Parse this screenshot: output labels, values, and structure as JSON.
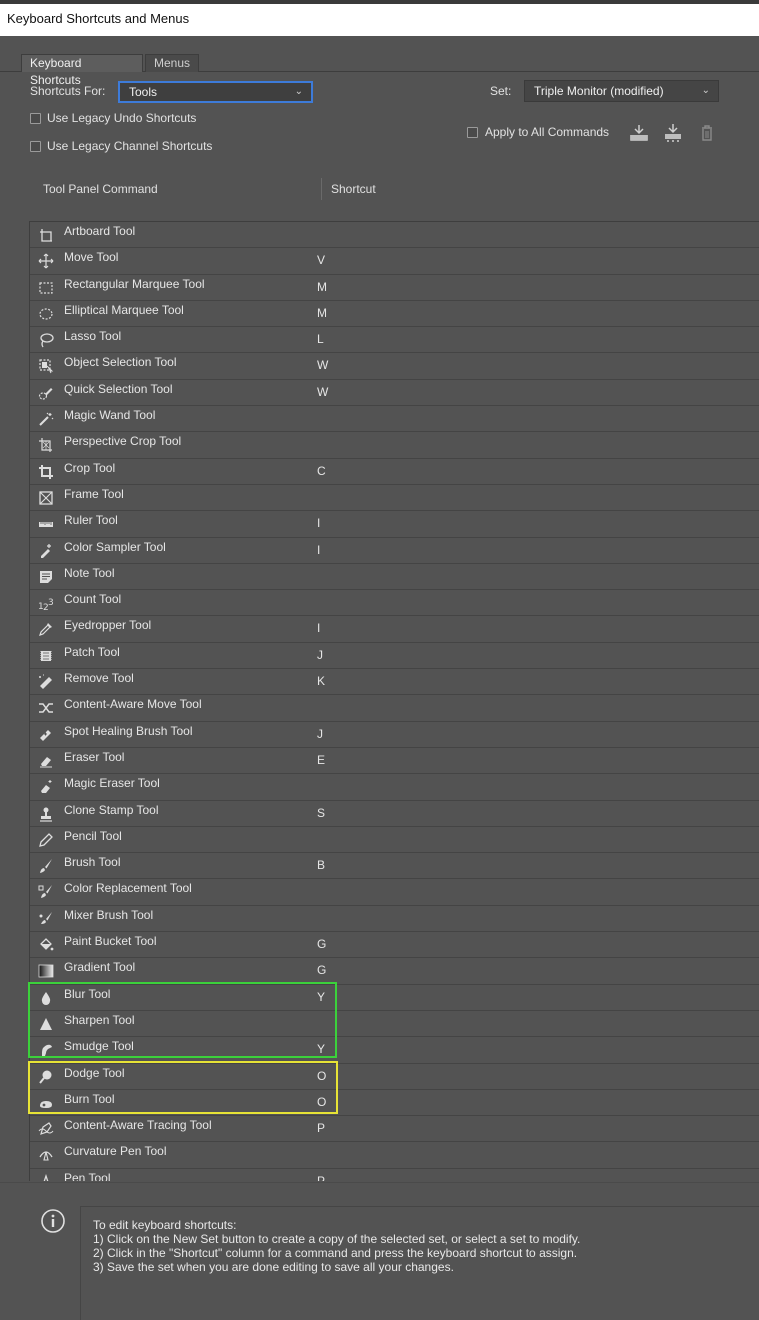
{
  "window": {
    "title": "Keyboard Shortcuts and Menus"
  },
  "tabs": [
    "Keyboard Shortcuts",
    "Menus"
  ],
  "shortcuts_for": {
    "label": "Shortcuts For:",
    "value": "Tools"
  },
  "set": {
    "label": "Set:",
    "value": "Triple Monitor (modified)"
  },
  "options": {
    "legacy_undo": "Use Legacy Undo Shortcuts",
    "legacy_channel": "Use Legacy Channel Shortcuts",
    "apply_all": "Apply to All Commands"
  },
  "columns": {
    "command": "Tool Panel Command",
    "shortcut": "Shortcut"
  },
  "tools": [
    {
      "name": "Artboard Tool",
      "key": "",
      "icon": "artboard-icon"
    },
    {
      "name": "Move Tool",
      "key": "V",
      "icon": "move-icon"
    },
    {
      "name": "Rectangular Marquee Tool",
      "key": "M",
      "icon": "rect-marquee-icon"
    },
    {
      "name": "Elliptical Marquee Tool",
      "key": "M",
      "icon": "ellipse-marquee-icon"
    },
    {
      "name": "Lasso Tool",
      "key": "L",
      "icon": "lasso-icon"
    },
    {
      "name": "Object Selection Tool",
      "key": "W",
      "icon": "object-selection-icon"
    },
    {
      "name": "Quick Selection Tool",
      "key": "W",
      "icon": "quick-selection-icon"
    },
    {
      "name": "Magic Wand Tool",
      "key": "",
      "icon": "magic-wand-icon"
    },
    {
      "name": "Perspective Crop Tool",
      "key": "",
      "icon": "perspective-crop-icon"
    },
    {
      "name": "Crop Tool",
      "key": "C",
      "icon": "crop-icon"
    },
    {
      "name": "Frame Tool",
      "key": "",
      "icon": "frame-icon"
    },
    {
      "name": "Ruler Tool",
      "key": "I",
      "icon": "ruler-icon"
    },
    {
      "name": "Color Sampler Tool",
      "key": "I",
      "icon": "color-sampler-icon"
    },
    {
      "name": "Note Tool",
      "key": "",
      "icon": "note-icon"
    },
    {
      "name": "Count Tool",
      "key": "",
      "icon": "count-icon"
    },
    {
      "name": "Eyedropper Tool",
      "key": "I",
      "icon": "eyedropper-icon"
    },
    {
      "name": "Patch Tool",
      "key": "J",
      "icon": "patch-icon"
    },
    {
      "name": "Remove Tool",
      "key": "K",
      "icon": "remove-icon"
    },
    {
      "name": "Content-Aware Move Tool",
      "key": "",
      "icon": "content-aware-move-icon"
    },
    {
      "name": "Spot Healing Brush Tool",
      "key": "J",
      "icon": "spot-healing-icon"
    },
    {
      "name": "Eraser Tool",
      "key": "E",
      "icon": "eraser-icon"
    },
    {
      "name": "Magic Eraser Tool",
      "key": "",
      "icon": "magic-eraser-icon"
    },
    {
      "name": "Clone Stamp Tool",
      "key": "S",
      "icon": "clone-stamp-icon"
    },
    {
      "name": "Pencil Tool",
      "key": "",
      "icon": "pencil-icon"
    },
    {
      "name": "Brush Tool",
      "key": "B",
      "icon": "brush-icon"
    },
    {
      "name": "Color Replacement Tool",
      "key": "",
      "icon": "color-replacement-icon"
    },
    {
      "name": "Mixer Brush Tool",
      "key": "",
      "icon": "mixer-brush-icon"
    },
    {
      "name": "Paint Bucket Tool",
      "key": "G",
      "icon": "paint-bucket-icon"
    },
    {
      "name": "Gradient Tool",
      "key": "G",
      "icon": "gradient-icon"
    },
    {
      "name": "Blur Tool",
      "key": "Y",
      "icon": "blur-icon"
    },
    {
      "name": "Sharpen Tool",
      "key": "",
      "icon": "sharpen-icon"
    },
    {
      "name": "Smudge Tool",
      "key": "Y",
      "icon": "smudge-icon"
    },
    {
      "name": "Dodge Tool",
      "key": "O",
      "icon": "dodge-icon"
    },
    {
      "name": "Burn Tool",
      "key": "O",
      "icon": "burn-icon"
    },
    {
      "name": "Content-Aware Tracing Tool",
      "key": "P",
      "icon": "tracing-icon"
    },
    {
      "name": "Curvature Pen Tool",
      "key": "",
      "icon": "curvature-pen-icon"
    },
    {
      "name": "Pen Tool",
      "key": "P",
      "icon": "pen-icon"
    }
  ],
  "info": {
    "line0": "To edit keyboard shortcuts:",
    "line1": "1) Click on the New Set button to create a copy of the selected set, or select a set to modify.",
    "line2": "2) Click in the \"Shortcut\" column for a command and press the keyboard shortcut to assign.",
    "line3": "3) Save the set when you are done editing to save all your changes."
  },
  "colors": {
    "highlight_green": "#3bd13b",
    "highlight_yellow": "#e7e336",
    "focus_blue": "#3d7bd9"
  }
}
